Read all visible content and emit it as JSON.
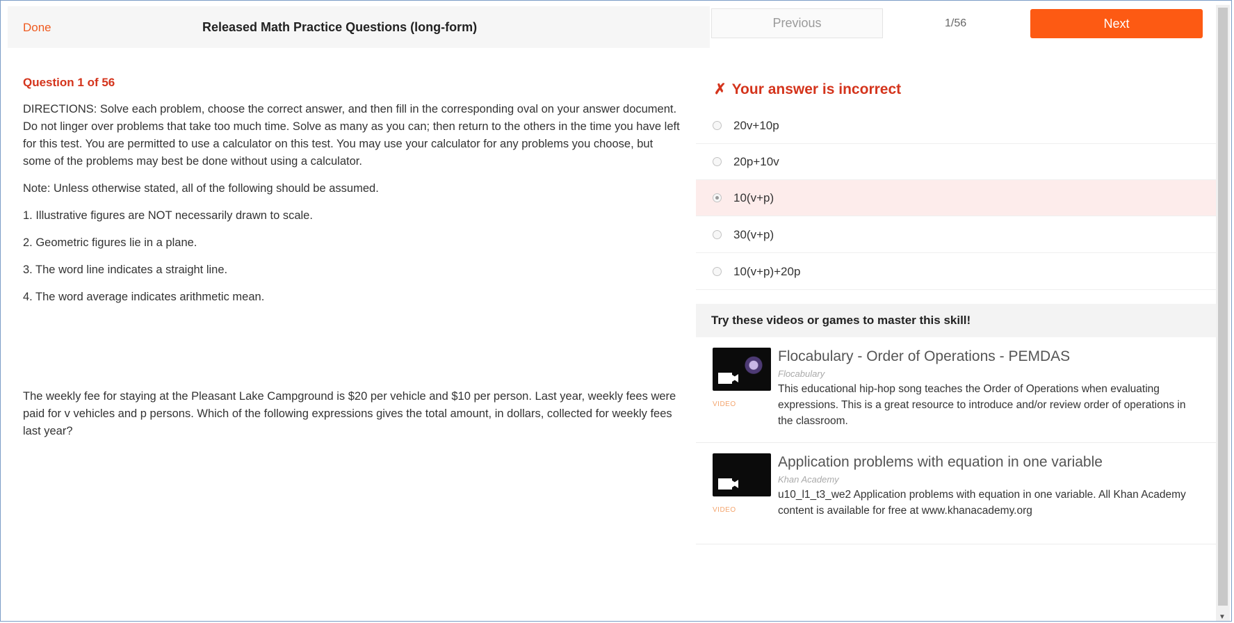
{
  "header": {
    "done_label": "Done",
    "title": "Released Math Practice Questions (long-form)",
    "previous_label": "Previous",
    "counter": "1/56",
    "next_label": "Next"
  },
  "question": {
    "label": "Question 1 of 56",
    "directions": "DIRECTIONS: Solve each problem, choose the correct answer, and then fill in the corresponding oval on your answer document. Do not linger over problems that take too much time. Solve as many as you can; then return to the others in the time you have left for this test. You are permitted to use a calculator on this test. You may use your calculator for any problems you choose, but some of the problems may best be done without using a calculator.",
    "note": "Note: Unless otherwise stated, all of the following should be assumed.",
    "assumptions": [
      "1. Illustrative figures are NOT necessarily drawn to scale.",
      "2. Geometric figures lie in a plane.",
      "3. The word line indicates a straight line.",
      "4. The word average indicates arithmetic mean."
    ],
    "text": "The weekly fee for staying at the Pleasant Lake Campground is $20 per vehicle and $10 per person. Last year, weekly fees were paid for v vehicles and p persons. Which of the following expressions gives the total amount, in dollars, collected for weekly fees last year?"
  },
  "result": {
    "icon": "✗",
    "message": "Your answer is incorrect"
  },
  "options": [
    {
      "label": "20v+10p",
      "selected": false
    },
    {
      "label": "20p+10v",
      "selected": false
    },
    {
      "label": "10(v+p)",
      "selected": true
    },
    {
      "label": "30(v+p)",
      "selected": false
    },
    {
      "label": "10(v+p)+20p",
      "selected": false
    }
  ],
  "skills": {
    "heading": "Try these videos or games to master this skill!",
    "resources": [
      {
        "type": "VIDEO",
        "title": "Flocabulary - Order of Operations - PEMDAS",
        "source": "Flocabulary",
        "description": "This educational hip-hop song teaches the Order of Operations when evaluating expressions. This is a great resource to introduce and/or review order of operations in the classroom."
      },
      {
        "type": "VIDEO",
        "title": "Application problems with equation in one variable",
        "source": "Khan Academy",
        "description": "u10_l1_t3_we2 Application problems with equation in one variable. All Khan Academy content is available for free at www.khanacademy.org"
      }
    ]
  },
  "colors": {
    "accent": "#fd5a13",
    "error": "#d4341c",
    "selected_bg": "#fdeceb"
  }
}
